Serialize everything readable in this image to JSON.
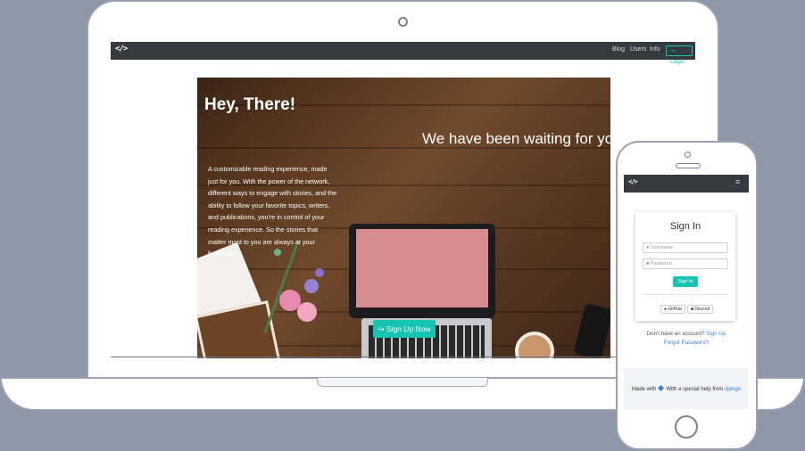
{
  "desktop": {
    "brand": "</>",
    "nav": {
      "links": [
        "Blog",
        "Users",
        "Info"
      ],
      "login": "Login"
    },
    "hero": {
      "title": "Hey, There!",
      "subtitle": "We have been waiting for you!",
      "description": "A customizable reading experience, made just for you. With the power of the network, different ways to engage with stories, and the ability to follow your favorite topics, writers, and publications, you're in control of your reading experience. So the stories that matter most to you are always at your fingertips.",
      "cta": "Sign Up Now"
    }
  },
  "mobile": {
    "brand": "</>",
    "menu_icon": "≡",
    "signin": {
      "title": "Sign In",
      "username_placeholder": "Username",
      "password_placeholder": "Password",
      "button": "Sign In",
      "github": "GitHub",
      "discord": "Discord"
    },
    "account_text": "Don't have an account?",
    "signup_link": "Sign Up",
    "forgot_link": "Forgot Password?",
    "footer": {
      "made_with": "Made with",
      "special_help": "With a special help from",
      "django": "django."
    }
  },
  "colors": {
    "accent": "#17c3b2",
    "navbar": "#343a40",
    "link": "#3b82d6"
  }
}
